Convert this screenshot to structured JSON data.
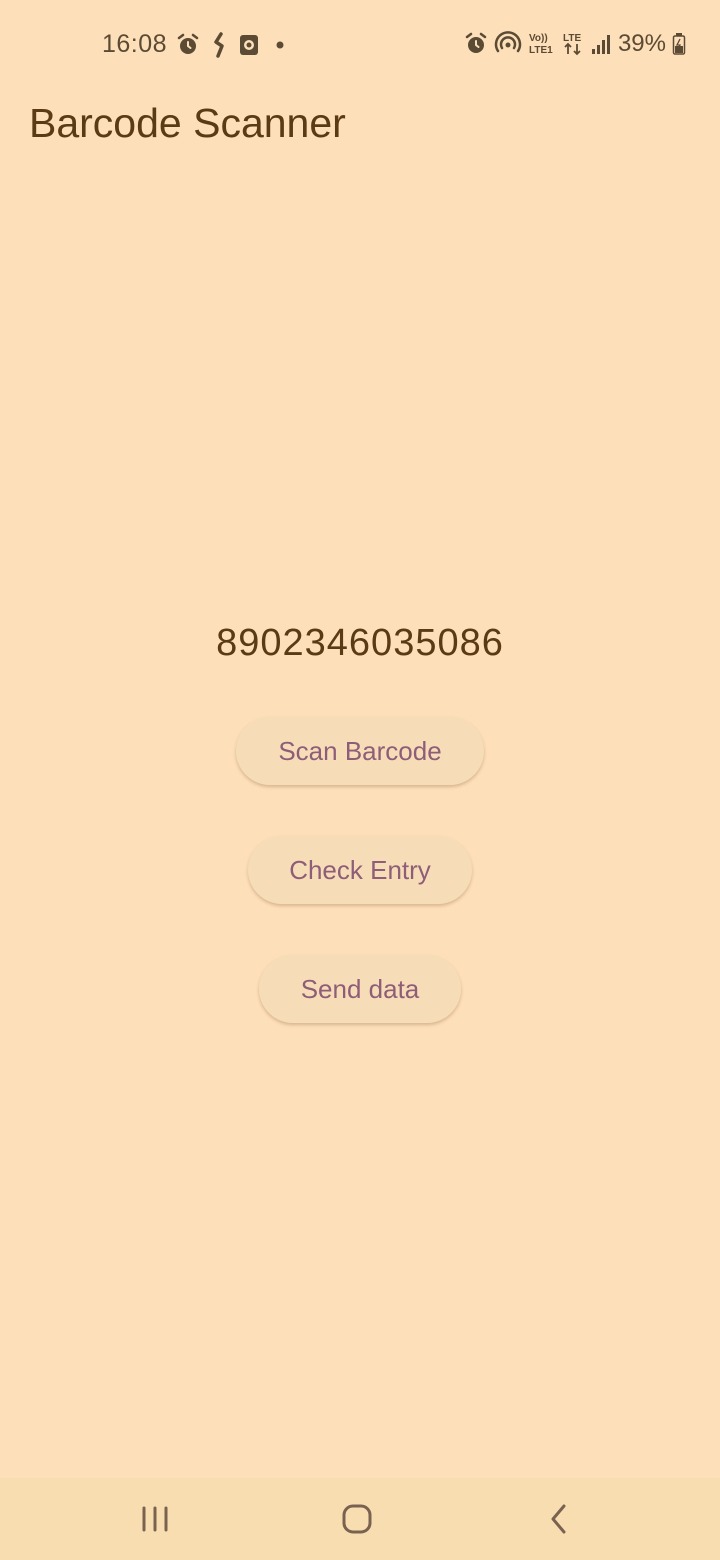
{
  "status_bar": {
    "time": "16:08",
    "battery": "39%",
    "left_icons": [
      "alarm-icon",
      "rupee-icon",
      "watch-icon",
      "dot-icon"
    ],
    "right_icons": [
      "alarm-icon",
      "hotspot-icon",
      "volte-icon",
      "lte-icon",
      "signal-icon",
      "battery-icon"
    ],
    "volte_label": "Vo)) LTE1",
    "lte_label": "LTE"
  },
  "app": {
    "title": "Barcode Scanner"
  },
  "main": {
    "barcode_value": "8902346035086",
    "buttons": {
      "scan": "Scan Barcode",
      "check": "Check Entry",
      "send": "Send data"
    }
  },
  "nav_bar": {
    "items": [
      "recents-icon",
      "home-icon",
      "back-icon"
    ]
  },
  "colors": {
    "background": "#fddfb9",
    "text": "#5b3a16",
    "button_background": "#f7ddb7",
    "button_text": "#8e5d78",
    "nav_background": "#f8ddb0"
  }
}
